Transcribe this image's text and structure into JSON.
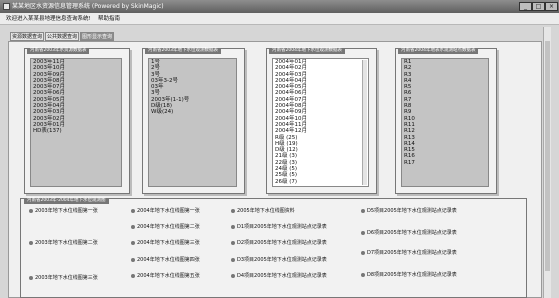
{
  "window": {
    "title": "某某地区水资源信息管理系统 (Powered by SkinMagic)",
    "controls": {
      "minimize": "_",
      "maximize": "□",
      "close": "×"
    }
  },
  "menu": {
    "items": [
      "欢迎进入某某县地理信息查询系统!",
      "帮助指南"
    ]
  },
  "tabs": [
    {
      "label": "资源数据查询"
    },
    {
      "label": "公共数据查询"
    },
    {
      "label": "图形显示查询",
      "active": true
    }
  ],
  "panels": [
    {
      "title": "河南省2003年水资源数据表",
      "items": [
        "2003年11月",
        "2003年10月",
        "2003年09月",
        "2003年08月",
        "2003年07月",
        "2003年06月",
        "2003年05月",
        "2003年04月",
        "2003年03月",
        "2003年02月",
        "2003年01月",
        "HD表(137)"
      ],
      "selected": -1
    },
    {
      "title": "河南省2003年地下水位观测数据表",
      "items": [
        "1号",
        "2号",
        "3号",
        "03年3-2号",
        "03年",
        "3号",
        "2003年(1-1)号",
        "D级(18)",
        "W级(24)"
      ],
      "selected": -1
    },
    {
      "title": "河南省2004年地下水位观测数据表",
      "items": [
        "2004年01月",
        "2004年02月",
        "2004年03月",
        "2004年04月",
        "2004年05月",
        "2004年06月",
        "2004年07月",
        "2004年08月",
        "2004年09月",
        "2004年10月",
        "2004年11月",
        "2004年12月",
        "R级 (25)",
        "H级 (19)",
        "D级 (12)",
        "21级 (3)",
        "22级 (3)",
        "24级 (5)",
        "25级 (5)",
        "26级 (7)"
      ],
      "selected": -1
    },
    {
      "title": "河南省2004年地表水观测站点数据表",
      "items": [
        "R1",
        "R2",
        "R3",
        "R4",
        "R5",
        "R6",
        "R7",
        "R8",
        "R9",
        "R10",
        "R11",
        "R12",
        "R13",
        "R14",
        "R15",
        "R16",
        "R17"
      ],
      "selected": -1
    }
  ],
  "bottom_panel": {
    "title": "河南省2003年-2004年地下水位观测图",
    "items": [
      "2003年地下水位线图第一张",
      "2004年地下水位线图第一张",
      "2005年地下水位线图资料",
      "D5项目2005年地下水位观测站点记录表",
      "2004年地下水位线图第二张",
      "D1项目2005年地下水位观测站点记录表",
      "D6项目2005年地下水位观测站点记录表",
      "2003年地下水位线图第二张",
      "2004年地下水位线图第三张",
      "D2项目2005年地下水位观测站点记录表",
      "2004年地下水位线图第四张",
      "D3项目2005年地下水位观测站点记录表",
      "D7项目2005年地下水位观测站点记录表",
      "2003年地下水位线图第三张",
      "2004年地下水位线图第五张",
      "D4项目2005年地下水位观测站点记录表",
      "D8项目2005年地下水位观测站点记录表"
    ]
  }
}
